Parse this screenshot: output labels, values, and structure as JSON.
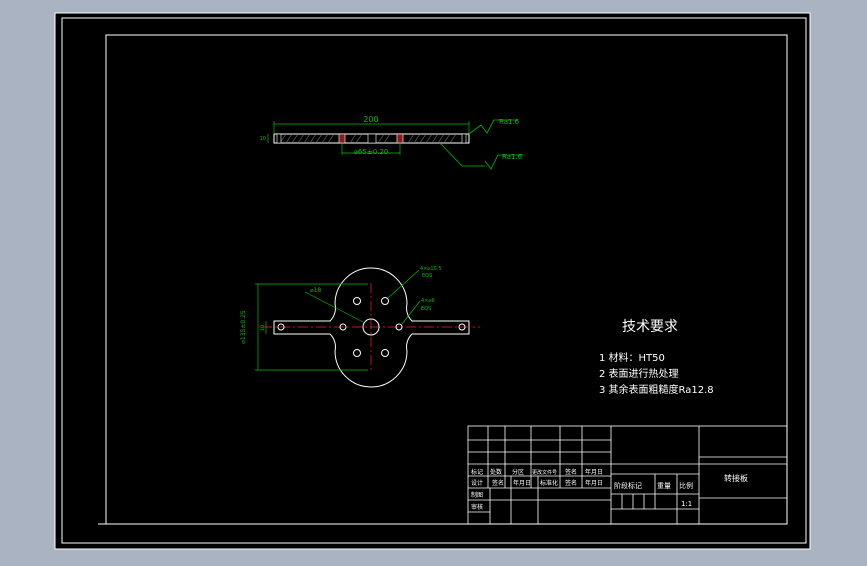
{
  "colors": {
    "viewport_bg": "#a9b3c1",
    "drawing_bg": "#000000",
    "line": "#ffffff",
    "dimension": "#00c000",
    "centerline": "#ff2020",
    "section": "#8b1a1a"
  },
  "top_view": {
    "length_label": "200",
    "bolt_circle_label": "⌀65±0.20",
    "thickness_label": "10",
    "roughness_1": "Ra1.6",
    "roughness_2": "Ra1.6"
  },
  "plan_view": {
    "small_hole_dia_label": "⌀18",
    "hole_callout_1_top": "4×⌀10.5",
    "hole_callout_1_bottom": "EQS",
    "hole_callout_2_top": "4×⌀6",
    "hole_callout_2_bottom": "EQS",
    "height_dim_label": "⌀135±0.25",
    "arm_width_label": "10"
  },
  "technical_requirements": {
    "title": "技术要求",
    "items": [
      "1  材料：HT50",
      "2  表面进行热处理",
      "3  其余表面粗糙度Ra12.8"
    ]
  },
  "title_block": {
    "row_labels_a": [
      "标记",
      "处数",
      "分区",
      "更改文件号",
      "签名",
      "年月日"
    ],
    "row_labels_b": [
      "设计",
      "签名",
      "年月日",
      "标准化",
      "签名",
      "年月日"
    ],
    "row_labels_c": [
      "制图"
    ],
    "row_labels_d": [
      "审核"
    ],
    "stage_label": "阶段标记",
    "weight_label": "重量",
    "scale_label": "比例",
    "scale_value": "1:1",
    "part_name": "转接板"
  }
}
